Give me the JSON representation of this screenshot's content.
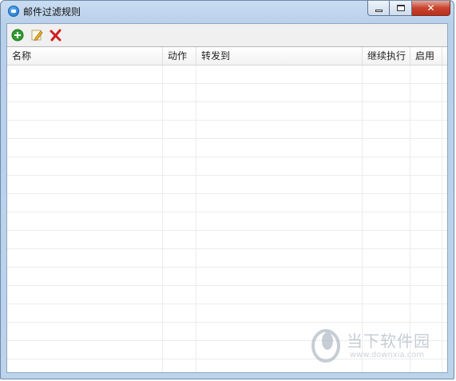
{
  "window": {
    "title": "邮件过滤规则"
  },
  "toolbar": {
    "add_icon": "add-icon",
    "edit_icon": "edit-icon",
    "delete_icon": "delete-icon"
  },
  "table": {
    "columns": [
      "名称",
      "动作",
      "转发到",
      "继续执行",
      "启用"
    ],
    "rows": []
  },
  "watermark": {
    "title": "当下软件园",
    "url": "www.downxia.com"
  },
  "colors": {
    "titlebar": "#c9dcf1",
    "close": "#c8422d",
    "add": "#2e9e2e",
    "delete": "#d01f1f"
  }
}
